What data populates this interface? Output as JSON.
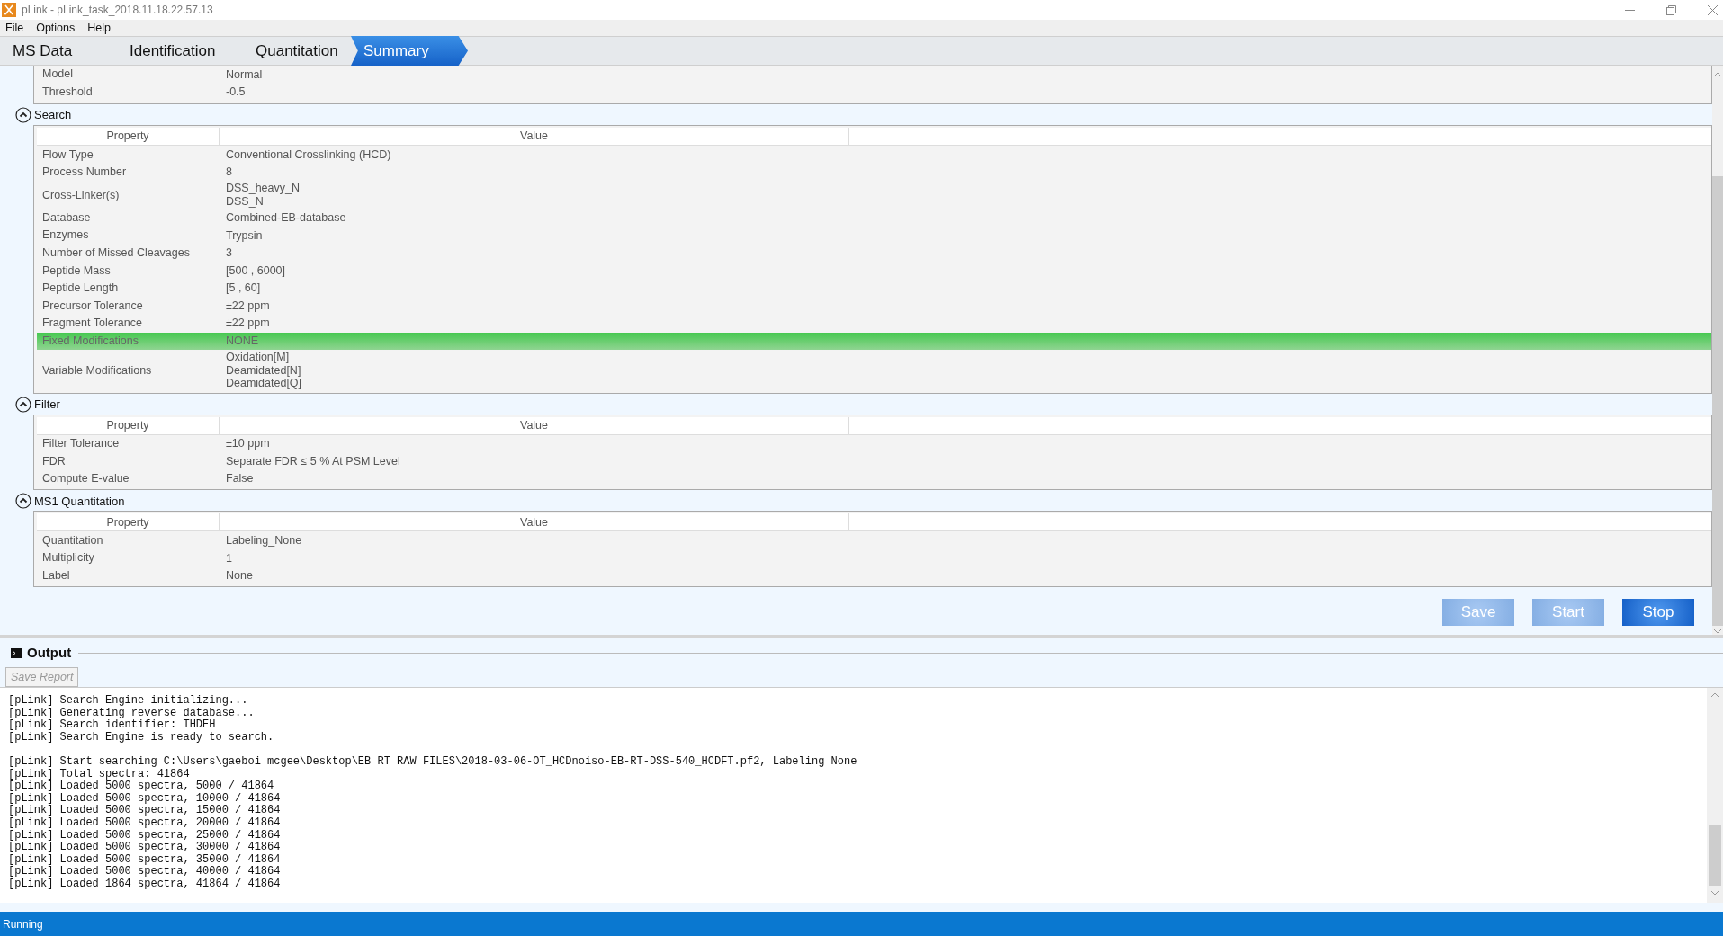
{
  "window": {
    "title": "pLink - pLink_task_2018.11.18.22.57.13"
  },
  "menu": [
    "File",
    "Options",
    "Help"
  ],
  "tabs": [
    {
      "label": "MS Data",
      "selected": false
    },
    {
      "label": "Identification",
      "selected": false
    },
    {
      "label": "Quantitation",
      "selected": false
    },
    {
      "label": "Summary",
      "selected": true
    }
  ],
  "summary": {
    "sections": [
      {
        "rows": [
          {
            "property": "Model",
            "value": [
              "Normal"
            ],
            "selected": false
          },
          {
            "property": "Threshold",
            "value": [
              "-0.5"
            ],
            "selected": false
          }
        ]
      },
      {
        "title": "Search",
        "expanded": true,
        "columns": [
          "Property",
          "Value"
        ],
        "rows": [
          {
            "property": "Flow Type",
            "value": [
              "Conventional Crosslinking (HCD)"
            ],
            "selected": false
          },
          {
            "property": "Process Number",
            "value": [
              "8"
            ],
            "selected": false
          },
          {
            "property": "Cross-Linker(s)",
            "value": [
              "DSS_heavy_N",
              "DSS_N"
            ],
            "selected": false
          },
          {
            "property": "Database",
            "value": [
              "Combined-EB-database"
            ],
            "selected": false
          },
          {
            "property": "Enzymes",
            "value": [
              "Trypsin"
            ],
            "selected": false
          },
          {
            "property": "Number of Missed Cleavages",
            "value": [
              "3"
            ],
            "selected": false
          },
          {
            "property": "Peptide Mass",
            "value": [
              "[500 , 6000]"
            ],
            "selected": false
          },
          {
            "property": "Peptide Length",
            "value": [
              "[5 , 60]"
            ],
            "selected": false
          },
          {
            "property": "Precursor Tolerance",
            "value": [
              "±22 ppm"
            ],
            "selected": false
          },
          {
            "property": "Fragment Tolerance",
            "value": [
              "±22 ppm"
            ],
            "selected": false
          },
          {
            "property": "Fixed Modifications",
            "value": [
              "NONE"
            ],
            "selected": true
          },
          {
            "property": "Variable Modifications",
            "value": [
              "Oxidation[M]",
              "Deamidated[N]",
              "Deamidated[Q]"
            ],
            "selected": false
          }
        ]
      },
      {
        "title": "Filter",
        "expanded": true,
        "columns": [
          "Property",
          "Value"
        ],
        "rows": [
          {
            "property": "Filter Tolerance",
            "value": [
              "±10 ppm"
            ],
            "selected": false
          },
          {
            "property": "FDR",
            "value": [
              "Separate FDR ≤ 5 % At PSM Level"
            ],
            "selected": false
          },
          {
            "property": "Compute E-value",
            "value": [
              "False"
            ],
            "selected": false
          }
        ]
      },
      {
        "title": "MS1 Quantitation",
        "expanded": true,
        "columns": [
          "Property",
          "Value"
        ],
        "rows": [
          {
            "property": "Quantitation",
            "value": [
              "Labeling_None"
            ],
            "selected": false
          },
          {
            "property": "Multiplicity",
            "value": [
              "1"
            ],
            "selected": false
          },
          {
            "property": "Label",
            "value": [
              "None"
            ],
            "selected": false
          }
        ]
      }
    ],
    "buttons": [
      {
        "label": "Save",
        "disabled": true
      },
      {
        "label": "Start",
        "disabled": true
      },
      {
        "label": "Stop",
        "disabled": false
      }
    ]
  },
  "output": {
    "title": "Output",
    "save_button": {
      "label": "Save Report",
      "disabled": true
    },
    "log_blocks": [
      [
        "[pLink] Search Engine initializing...",
        "[pLink] Generating reverse database...",
        "[pLink] Search identifier: THDEH",
        "[pLink] Search Engine is ready to search."
      ],
      [
        "[pLink] Start searching C:\\Users\\gaeboi mcgee\\Desktop\\EB RT RAW FILES\\2018-03-06-OT_HCDnoiso-EB-RT-DSS-540_HCDFT.pf2, Labeling None",
        "[pLink] Total spectra: 41864",
        "[pLink] Loaded 5000 spectra, 5000 / 41864",
        "[pLink] Loaded 5000 spectra, 10000 / 41864",
        "[pLink] Loaded 5000 spectra, 15000 / 41864",
        "[pLink] Loaded 5000 spectra, 20000 / 41864",
        "[pLink] Loaded 5000 spectra, 25000 / 41864",
        "[pLink] Loaded 5000 spectra, 30000 / 41864",
        "[pLink] Loaded 5000 spectra, 35000 / 41864",
        "[pLink] Loaded 5000 spectra, 40000 / 41864",
        "[pLink] Loaded 1864 spectra, 41864 / 41864"
      ]
    ]
  },
  "status_bar": {
    "text": "Running"
  }
}
